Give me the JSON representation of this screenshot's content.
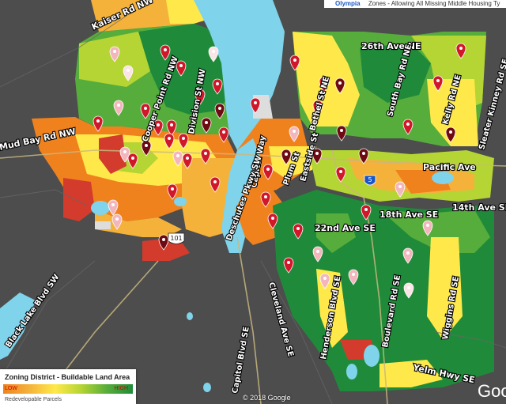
{
  "header": {
    "title": "Olympia",
    "subtitle": "Zones - Allowing All Missing Middle Housing Ty"
  },
  "legend": {
    "title": "Zoning District - Buildable Land Area",
    "low": "LOW",
    "high": "HIGH",
    "sub": "Redevelopable Parcels"
  },
  "roads": {
    "kaiser": "Kaiser Rd NW",
    "ave26": "26th Ave NE",
    "bethel": "Bethel St NE",
    "southbay": "South Bay Rd NE",
    "kelly": "Kelly Rd NE",
    "sleater": "Sleater Kinney Rd SE",
    "cooper": "Cooper Point Rd NW",
    "division": "Division St NW",
    "mudbay": "Mud Bay Rd NW",
    "capitol": "Capitol Way",
    "plum": "Plum St",
    "eastside": "Eastside St",
    "deschutes": "Deschutes Pkwy SW",
    "pacific": "Pacific Ave",
    "ave14": "14th Ave SE",
    "ave18": "18th Ave SE",
    "ave22": "22nd Ave SE",
    "cleveland": "Cleveland Ave SE",
    "henderson": "Henderson Blvd SE",
    "boulevard": "Boulevard Rd SE",
    "wiggins": "Wiggins Rd SE",
    "blacklake": "Black Lake Blvd SW",
    "capitolblvd": "Capitol Blvd SE",
    "yelm": "Yelm Hwy SE",
    "i5": "5",
    "us101": "101"
  },
  "footer": {
    "copyright": "© 2018 Google",
    "google": "Goog"
  },
  "colors": {
    "high": "#1f8b3a",
    "midhigh": "#57ad3b",
    "mid": "#b5d534",
    "yellow": "#ffe94a",
    "orange": "#f4b23a",
    "low": "#f0821e",
    "red": "#d33b2c",
    "water": "#7fd3ea",
    "background": "#4a4a4a"
  }
}
